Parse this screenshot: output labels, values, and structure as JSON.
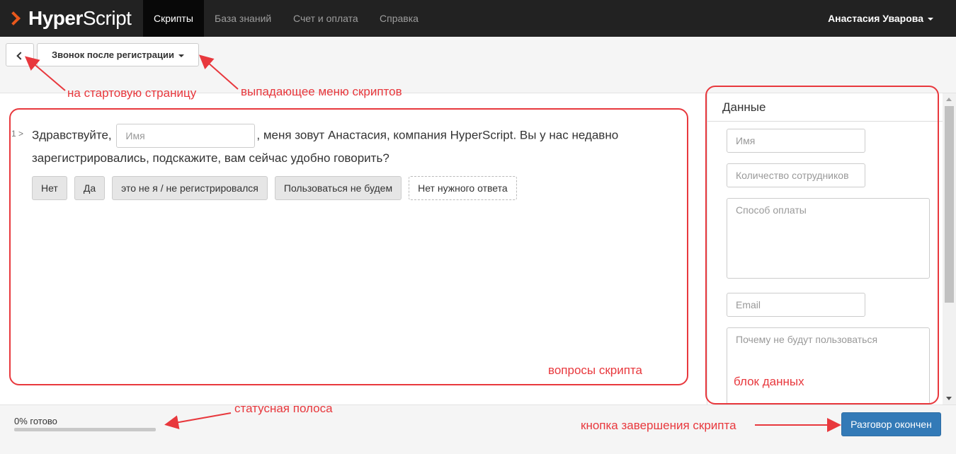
{
  "brand": {
    "name_bold": "Hyper",
    "name_light": "Script"
  },
  "nav": {
    "items": [
      {
        "label": "Скрипты",
        "active": true
      },
      {
        "label": "База знаний"
      },
      {
        "label": "Счет и оплата"
      },
      {
        "label": "Справка"
      }
    ],
    "user": "Анастасия Уварова"
  },
  "toolbar": {
    "back_icon": "chevron-left-icon",
    "script_selector": "Звонок после регистрации"
  },
  "script": {
    "line_number": "1 >",
    "question_before": "Здравствуйте,",
    "name_placeholder": "Имя",
    "question_after": ", меня зовут Анастасия, компания HyperScript. Вы у нас недавно зарегистрировались, подскажите, вам сейчас удобно говорить?",
    "answers": [
      "Нет",
      "Да",
      "это не я / не регистрировался",
      "Пользоваться не будем",
      "Нет нужного ответа"
    ]
  },
  "data_panel": {
    "title": "Данные",
    "fields": [
      {
        "placeholder": "Имя"
      },
      {
        "placeholder": "Количество сотрудников"
      },
      {
        "placeholder": "Способ оплаты"
      },
      {
        "placeholder": "Email"
      },
      {
        "placeholder": "Почему не будут пользоваться"
      }
    ]
  },
  "status": {
    "progress_label": "0% готово",
    "progress_fraction": 0,
    "end_button": "Разговор окончен"
  },
  "annotations": {
    "home": "на стартовую страницу",
    "dropdown": "выпадающее меню скриптов",
    "questions": "вопросы скрипта",
    "data_block": "блок данных",
    "status_bar": "статусная полоса",
    "finish_button": "кнопка завершения скрипта"
  },
  "colors": {
    "navbar": "#222222",
    "accent": "#337ab7",
    "brand_chevron": "#e8581c",
    "annotation": "#e8383d"
  }
}
